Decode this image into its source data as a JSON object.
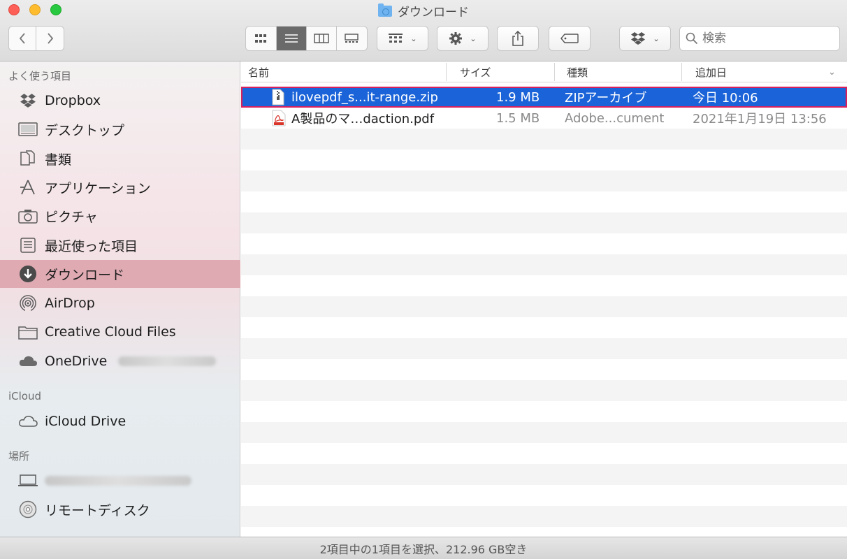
{
  "window": {
    "title": "ダウンロード",
    "folder_icon": "downloads-folder-icon"
  },
  "toolbar": {
    "view_modes": [
      "icon-view",
      "list-view",
      "column-view",
      "gallery-view"
    ],
    "active_view": "list-view",
    "search_placeholder": "検索"
  },
  "sidebar": {
    "favorites_title": "よく使う項目",
    "favorites": [
      {
        "label": "Dropbox",
        "icon": "dropbox-icon"
      },
      {
        "label": "デスクトップ",
        "icon": "desktop-icon"
      },
      {
        "label": "書類",
        "icon": "documents-icon"
      },
      {
        "label": "アプリケーション",
        "icon": "applications-icon"
      },
      {
        "label": "ピクチャ",
        "icon": "camera-icon"
      },
      {
        "label": "最近使った項目",
        "icon": "recents-icon"
      },
      {
        "label": "ダウンロード",
        "icon": "download-icon",
        "selected": true
      },
      {
        "label": "AirDrop",
        "icon": "airdrop-icon"
      },
      {
        "label": "Creative Cloud Files",
        "icon": "folder-icon"
      },
      {
        "label": "OneDrive",
        "icon": "cloud-icon"
      }
    ],
    "icloud_title": "iCloud",
    "icloud": [
      {
        "label": "iCloud Drive",
        "icon": "icloud-icon"
      }
    ],
    "locations_title": "場所",
    "locations": [
      {
        "label": "",
        "icon": "laptop-icon",
        "blurred": true
      },
      {
        "label": "リモートディスク",
        "icon": "disc-icon"
      }
    ]
  },
  "list": {
    "columns": [
      "名前",
      "サイズ",
      "種類",
      "追加日"
    ],
    "rows": [
      {
        "name": "ilovepdf_s...it-range.zip",
        "size": "1.9 MB",
        "kind": "ZIPアーカイブ",
        "date": "今日 10:06",
        "icon": "zip-file-icon",
        "selected": true
      },
      {
        "name": "A製品のマ…daction.pdf",
        "size": "1.5 MB",
        "kind": "Adobe...cument",
        "date": "2021年1月19日 13:56",
        "icon": "pdf-file-icon",
        "selected": false
      }
    ]
  },
  "status": {
    "text": "2項目中の1項目を選択、212.96 GB空き"
  },
  "colors": {
    "selection_blue": "#1a63d8",
    "sidebar_selected": "#dfaab2",
    "highlight_outline": "#d8205d"
  }
}
